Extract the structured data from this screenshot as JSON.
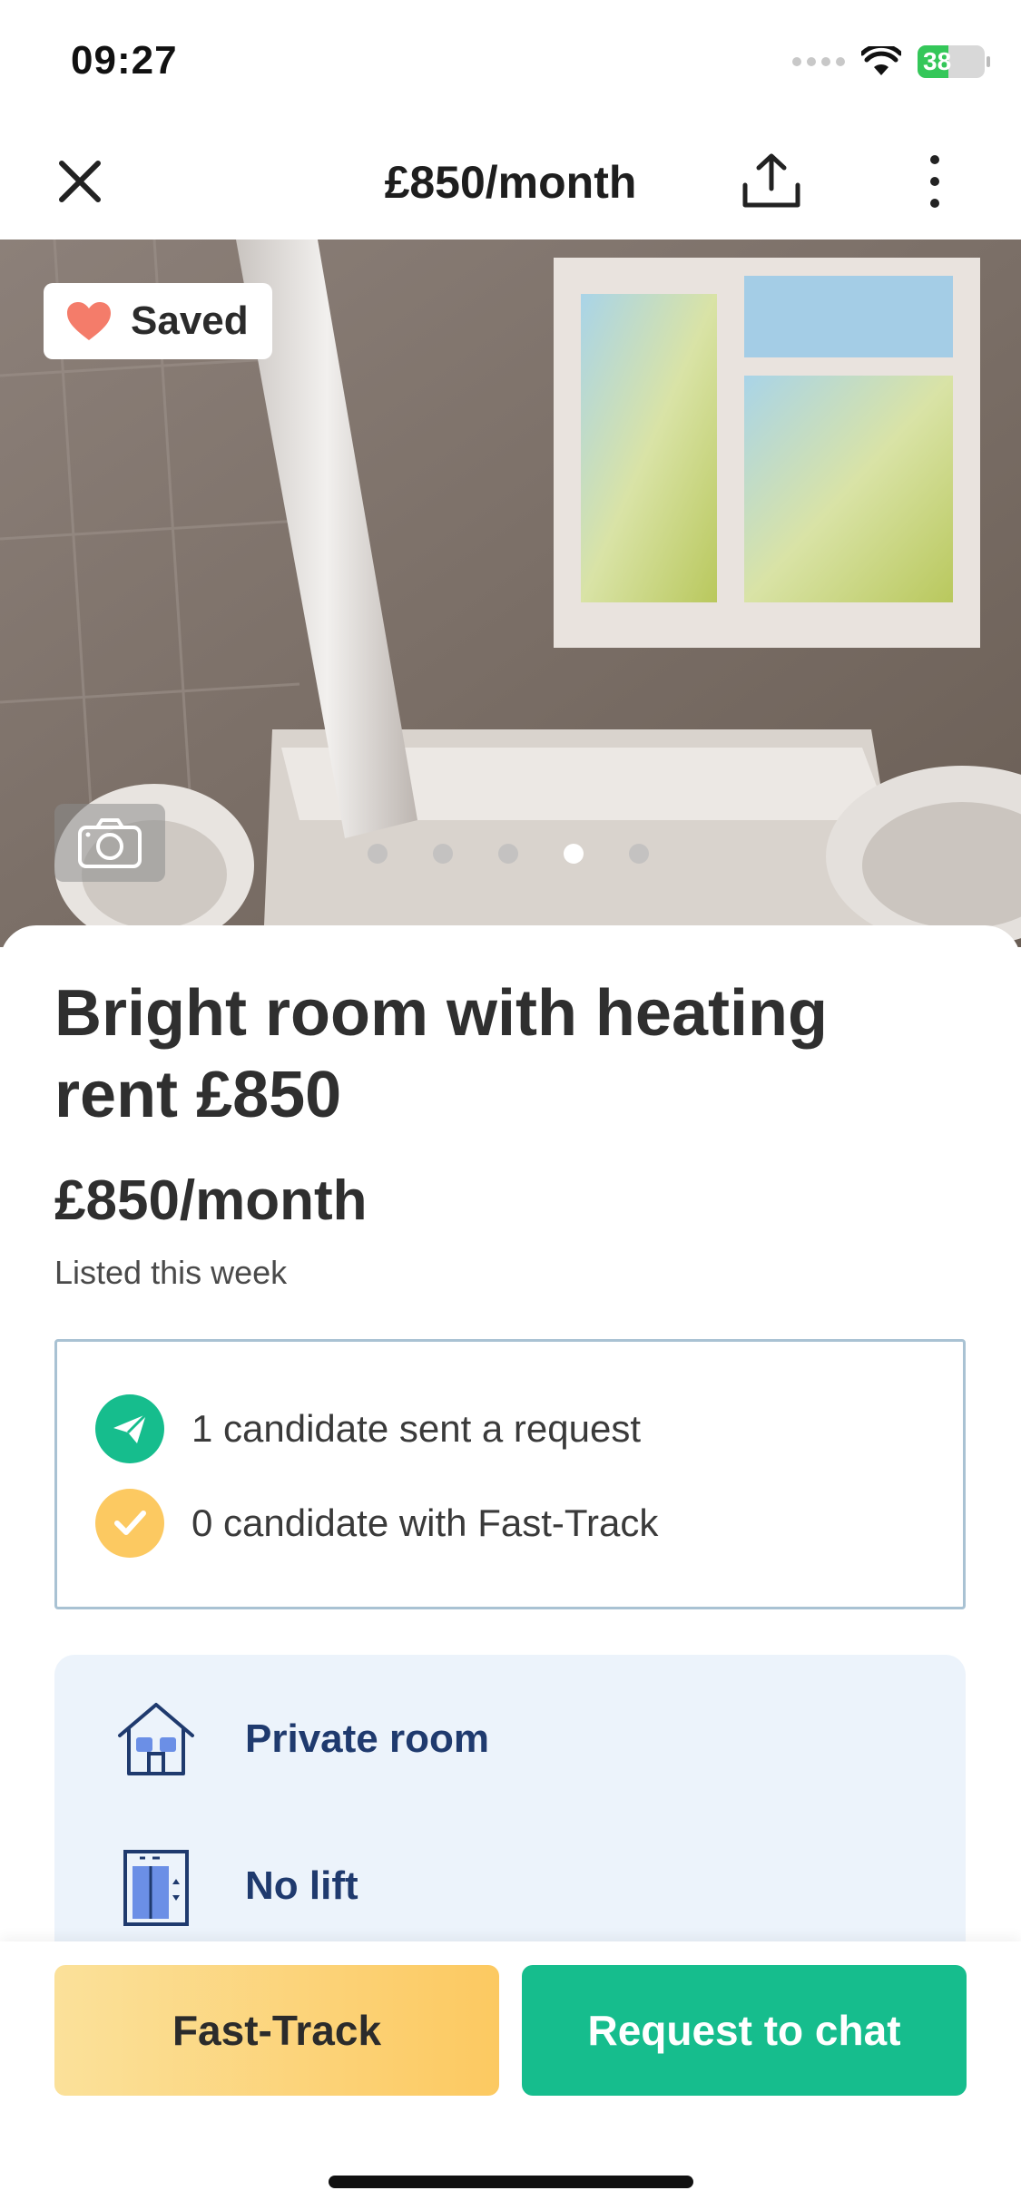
{
  "status_bar": {
    "time": "09:27",
    "battery": "38"
  },
  "nav": {
    "title": "£850/month",
    "close_icon": "close-icon",
    "share_icon": "share-icon",
    "more_icon": "more-vertical-icon"
  },
  "hero": {
    "saved_label": "Saved",
    "photo_count": 5,
    "active_photo_index": 4
  },
  "listing": {
    "title": "Bright room with heating rent £850",
    "price": "£850/month",
    "listed": "Listed this week"
  },
  "candidates": [
    {
      "text": "1 candidate sent a request",
      "icon": "send-icon",
      "color": "#16bd8d"
    },
    {
      "text": "0 candidate with Fast-Track",
      "icon": "check-icon",
      "color": "#fcc961"
    }
  ],
  "features": [
    {
      "label": "Private room",
      "icon": "house-icon"
    },
    {
      "label": "No lift",
      "icon": "lift-icon"
    }
  ],
  "actions": {
    "fast_track": "Fast-Track",
    "request_chat": "Request to chat"
  },
  "colors": {
    "accent_green": "#16bd8d",
    "accent_yellow": "#fcc961",
    "feature_text": "#1f3a6e",
    "saved_heart": "#f47c6a"
  }
}
